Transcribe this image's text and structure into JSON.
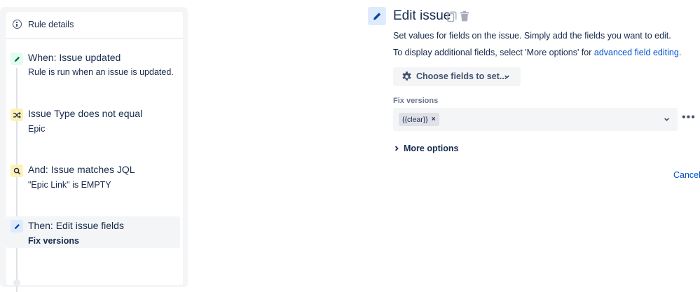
{
  "sidebar": {
    "rule_details_label": "Rule details",
    "steps": [
      {
        "icon": "pencil-icon",
        "title": "When: Issue updated",
        "desc": "Rule is run when an issue is updated.",
        "color": "#e3fcef"
      },
      {
        "icon": "shuffle-icon",
        "title": "Issue Type does not equal",
        "desc": "Epic",
        "color": "#fff0b3"
      },
      {
        "icon": "search-icon",
        "title": "And: Issue matches JQL",
        "desc": "\"Epic Link\" is EMPTY",
        "color": "#fff0b3"
      },
      {
        "icon": "pencil-icon",
        "title": "Then: Edit issue fields",
        "desc": "Fix versions",
        "color": "#deebff",
        "active": true
      }
    ]
  },
  "editor": {
    "title": "Edit issue",
    "help_line_1": "Set values for fields on the issue. Simply add the fields you want to edit.",
    "help_line_2_prefix": "To display additional fields, select 'More options' for ",
    "help_line_2_link": "advanced field editing",
    "help_line_2_suffix": ".",
    "choose_fields_label": "Choose fields to set...",
    "fix_versions_label": "Fix versions",
    "fix_versions_value": "{{clear}}",
    "more_options_label": "More options",
    "cancel_label": "Cancel"
  },
  "colors": {
    "link": "#0052cc",
    "text": "#172b4d",
    "panel_bg": "#f4f5f7"
  }
}
